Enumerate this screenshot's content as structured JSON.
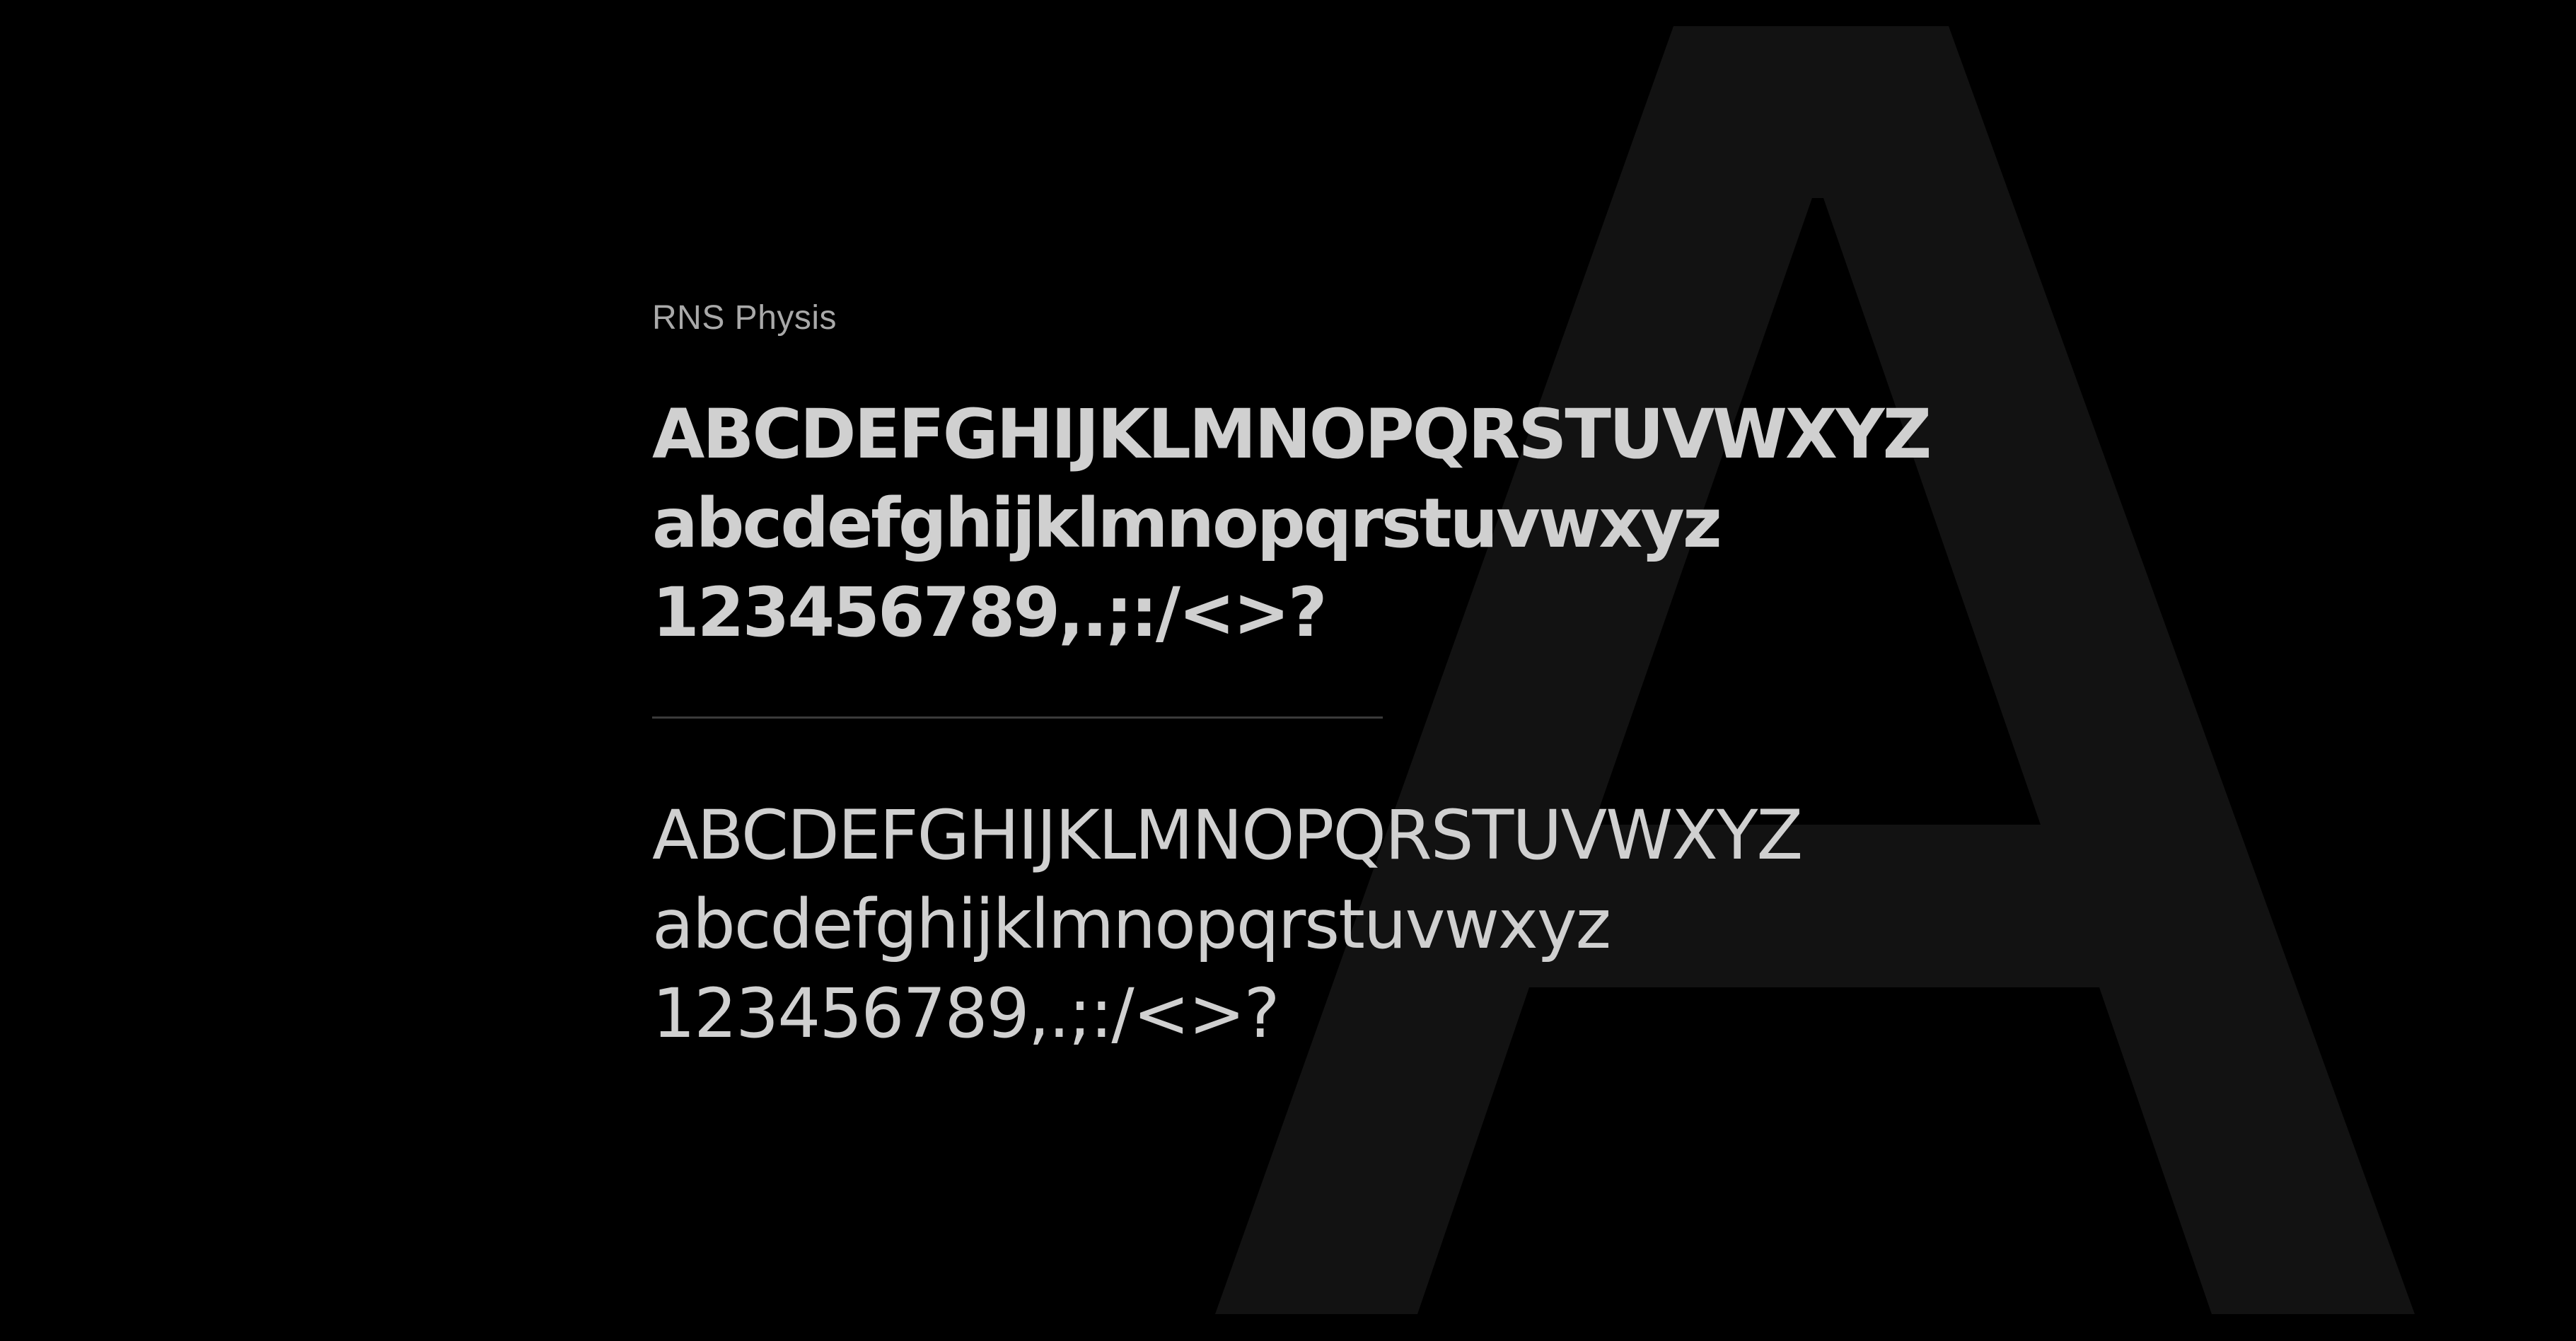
{
  "specimen": {
    "font_name": "RNS Physis",
    "bold": {
      "uppercase": "ABCDEFGHIJKLMNOPQRSTUVWXYZ",
      "lowercase": "abcdefghijklmnopqrstuvwxyz",
      "numerals": "123456789,.;:/<>?"
    },
    "regular": {
      "uppercase": "ABCDEFGHIJKLMNOPQRSTUVWXYZ",
      "lowercase": "abcdefghijklmnopqrstuvwxyz",
      "numerals": "123456789,.;:/<>?"
    }
  },
  "colors": {
    "background": "#000000",
    "backdrop_letter": "#121212",
    "glyph_text": "#d0d0d0",
    "label_text": "#a9a9a9",
    "divider": "#3a3a3a"
  }
}
